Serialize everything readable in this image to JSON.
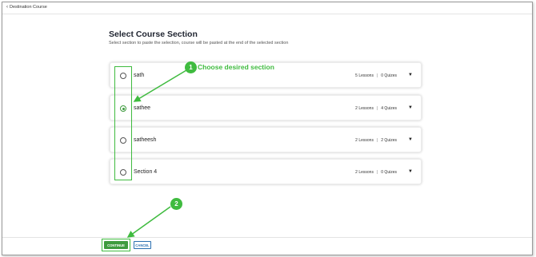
{
  "nav": {
    "back_label": "Destination Course",
    "back_icon": "chevron-left-icon"
  },
  "page": {
    "title": "Select Course Section",
    "subtitle": "Select section to paste the selection, course will be pasted at the end of the selected section"
  },
  "sections": [
    {
      "name": "sath",
      "lessons": "5 Lessons",
      "quizzes": "0 Quizes",
      "selected": false
    },
    {
      "name": "sathee",
      "lessons": "2 Lessons",
      "quizzes": "4 Quizes",
      "selected": true
    },
    {
      "name": "satheesh",
      "lessons": "2 Lessons",
      "quizzes": "2 Quizes",
      "selected": false
    },
    {
      "name": "Section 4",
      "lessons": "2 Lessons",
      "quizzes": "0 Quizes",
      "selected": false
    }
  ],
  "meta_separator": "|",
  "actions": {
    "continue_label": "CONTINUE",
    "cancel_label": "CANCEL"
  },
  "annotations": {
    "callout1_number": "1",
    "callout1_label": "Choose desired section",
    "callout2_number": "2",
    "color": "#3fbb3f"
  },
  "colors": {
    "primary": "#3f9b3f",
    "cancel": "#2a6fb0"
  }
}
